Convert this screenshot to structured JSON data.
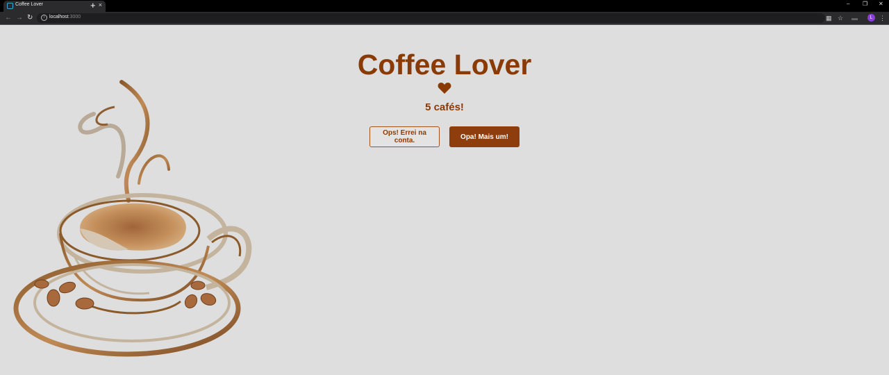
{
  "browser": {
    "tab_title": "Coffee Lover",
    "tab_close": "×",
    "new_tab": "+",
    "url_host": "localhost",
    "url_port": ":3000",
    "avatar_letter": "L"
  },
  "page": {
    "title": "Coffee Lover",
    "count_text": "5 cafés!",
    "decrement_button": "Ops! Errei na conta.",
    "increment_button": "Opa! Mais um!"
  },
  "colors": {
    "background": "#dedede",
    "brand_brown": "#8a3a05",
    "button_solid": "#8e3e0c"
  }
}
